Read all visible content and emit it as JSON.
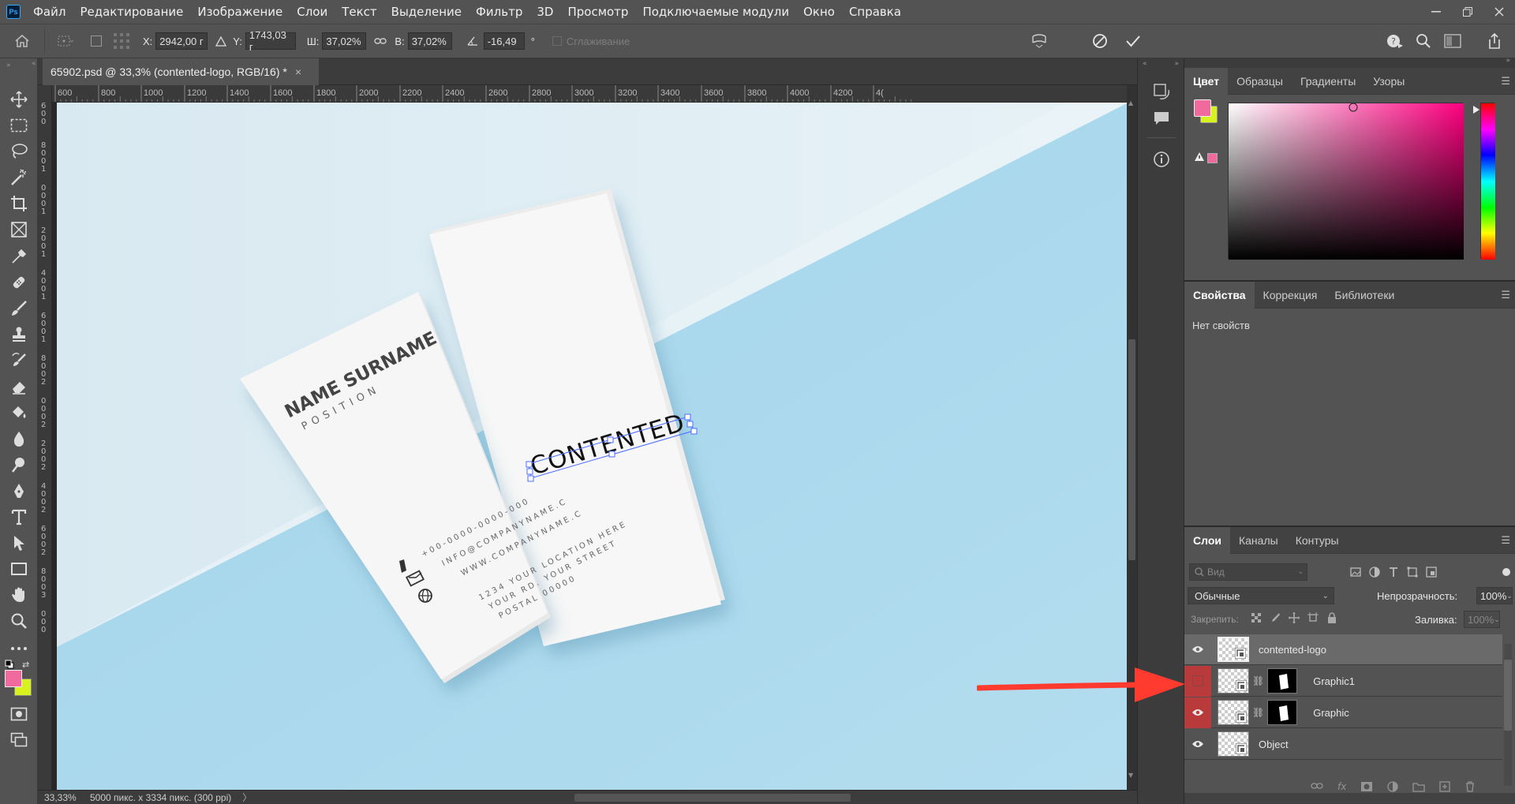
{
  "app": {
    "logo_text": "Ps"
  },
  "menu": [
    "Файл",
    "Редактирование",
    "Изображение",
    "Слои",
    "Текст",
    "Выделение",
    "Фильтр",
    "3D",
    "Просмотр",
    "Подключаемые модули",
    "Окно",
    "Справка"
  ],
  "options": {
    "x_label": "X:",
    "x_value": "2942,00 г",
    "y_label": "Y:",
    "y_value": "1743,03 г",
    "w_label": "Ш:",
    "w_value": "37,02%",
    "h_label": "В:",
    "h_value": "37,02%",
    "angle_value": "-16,49",
    "angle_unit": "°",
    "antialias_label": "Сглаживание"
  },
  "document": {
    "tab_title": "65902.psd @ 33,3% (contented-logo, RGB/16) *",
    "close_glyph": "×"
  },
  "ruler": {
    "top": [
      "600",
      "800",
      "1000",
      "1200",
      "1400",
      "1600",
      "1800",
      "2000",
      "2200",
      "2400",
      "2600",
      "2800",
      "3000",
      "3200",
      "3400",
      "3600",
      "3800",
      "4000",
      "4200",
      "4("
    ],
    "left": [
      "6",
      "0",
      "0",
      "8",
      "0",
      "0",
      "1",
      "0",
      "0",
      "0",
      "1",
      "2",
      "0",
      "0",
      "1",
      "4",
      "0",
      "0",
      "1",
      "6",
      "0",
      "0",
      "1",
      "8",
      "0",
      "0",
      "2",
      "0",
      "0",
      "0",
      "2",
      "2",
      "0",
      "0",
      "2",
      "4",
      "0",
      "0",
      "2",
      "6",
      "0",
      "0",
      "2",
      "8",
      "0",
      "0",
      "3",
      "0",
      "0",
      "0"
    ]
  },
  "mockup": {
    "name_surname": "NAME SURNAME",
    "position": "POSITION",
    "phone": "+00-0000-0000-000",
    "email": "INFO@COMPANYNAME.C",
    "website": "WWW.COMPANYNAME.C",
    "address1": "1234 YOUR LOCATION HERE",
    "address2": "YOUR RD. YOUR STREET",
    "address3": "POSTAL 00000",
    "logo_text": "CONTENTED"
  },
  "status": {
    "zoom": "33,33%",
    "doc_info": "5000 пикс. x 3334 пикс. (300 ppi)",
    "arrow": "〉"
  },
  "color_panel": {
    "tabs": [
      "Цвет",
      "Образцы",
      "Градиенты",
      "Узоры"
    ],
    "foreground": "#f06a9e",
    "background": "#d7f21e",
    "hue": "#ff0080"
  },
  "properties_panel": {
    "tabs": [
      "Свойства",
      "Коррекция",
      "Библиотеки"
    ],
    "empty_text": "Нет свойств"
  },
  "layers_panel": {
    "tabs": [
      "Слои",
      "Каналы",
      "Контуры"
    ],
    "search_placeholder": "Вид",
    "blend_mode": "Обычные",
    "opacity_label": "Непрозрачность:",
    "opacity_value": "100%",
    "lock_label": "Закрепить:",
    "fill_label": "Заливка:",
    "fill_value": "100%",
    "layers": [
      {
        "name": "contented-logo",
        "visible": true,
        "selected": true,
        "mask": false
      },
      {
        "name": "Graphic1",
        "visible": false,
        "selected": false,
        "mask": true
      },
      {
        "name": "Graphic",
        "visible": true,
        "selected": false,
        "mask": true
      },
      {
        "name": "Object",
        "visible": true,
        "selected": false,
        "mask": false
      }
    ]
  },
  "colors": {
    "accent": "#ff3b30",
    "highlight_red": "#b83a3a",
    "sky": "#abd8ec"
  }
}
